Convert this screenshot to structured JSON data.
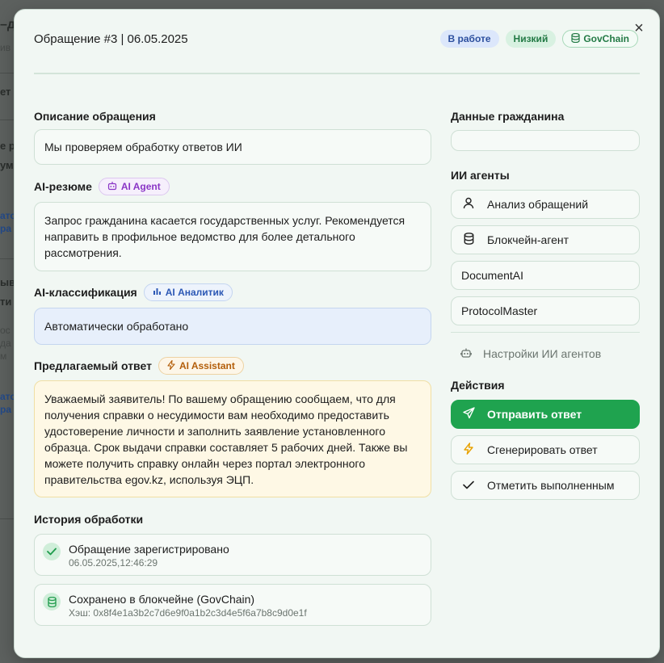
{
  "background": {
    "fragments": [
      "–д",
      "ив",
      "ет",
      "е р",
      "ум",
      "ато",
      "ра",
      "ыв",
      "ти",
      "ос",
      "да",
      "м",
      "ато",
      "ра"
    ]
  },
  "modal": {
    "title": "Обращение #3 | 06.05.2025",
    "close": "×",
    "badges": {
      "status": "В работе",
      "priority": "Низкий",
      "chain": "GovChain"
    }
  },
  "description": {
    "label": "Описание обращения",
    "text": "Мы проверяем обработку ответов ИИ"
  },
  "summary": {
    "label": "AI-резюме",
    "tag": "AI Agent",
    "text": "Запрос гражданина касается государственных услуг. Рекомендуется направить в профильное ведомство для более детального рассмотрения."
  },
  "classification": {
    "label": "AI-классификация",
    "tag": "AI Аналитик",
    "text": "Автоматически обработано"
  },
  "proposed": {
    "label": "Предлагаемый ответ",
    "tag": "AI Assistant",
    "text": "Уважаемый заявитель! По вашему обращению сообщаем, что для получения справки о несудимости вам необходимо предоставить удостоверение личности и заполнить заявление установленного образца. Срок выдачи справки составляет 5 рабочих дней. Также вы можете получить справку онлайн через портал электронного правительства egov.kz, используя ЭЦП."
  },
  "history": {
    "label": "История обработки",
    "items": [
      {
        "title": "Обращение зарегистрировано",
        "sub": "06.05.2025,12:46:29",
        "icon": "check-icon"
      },
      {
        "title": "Сохранено в блокчейне (GovChain)",
        "sub": "Хэш: 0x8f4e1a3b2c7d6e9f0a1b2c3d4e5f6a7b8c9d0e1f",
        "icon": "database-icon"
      }
    ]
  },
  "citizen": {
    "label": "Данные гражданина",
    "value": ""
  },
  "agents": {
    "label": "ИИ агенты",
    "items": [
      {
        "label": "Анализ обращений",
        "icon": "user-icon"
      },
      {
        "label": "Блокчейн-агент",
        "icon": "database-icon"
      },
      {
        "label": "DocumentAI",
        "icon": ""
      },
      {
        "label": "ProtocolMaster",
        "icon": ""
      }
    ],
    "settings": "Настройки ИИ агентов"
  },
  "actions": {
    "label": "Действия",
    "send": "Отправить ответ",
    "generate": "Сгенерировать ответ",
    "done": "Отметить выполненным"
  },
  "colors": {
    "accent": "#1fa34f",
    "status_badge": "#dce7fb",
    "priority_badge": "#d8f1e1"
  }
}
